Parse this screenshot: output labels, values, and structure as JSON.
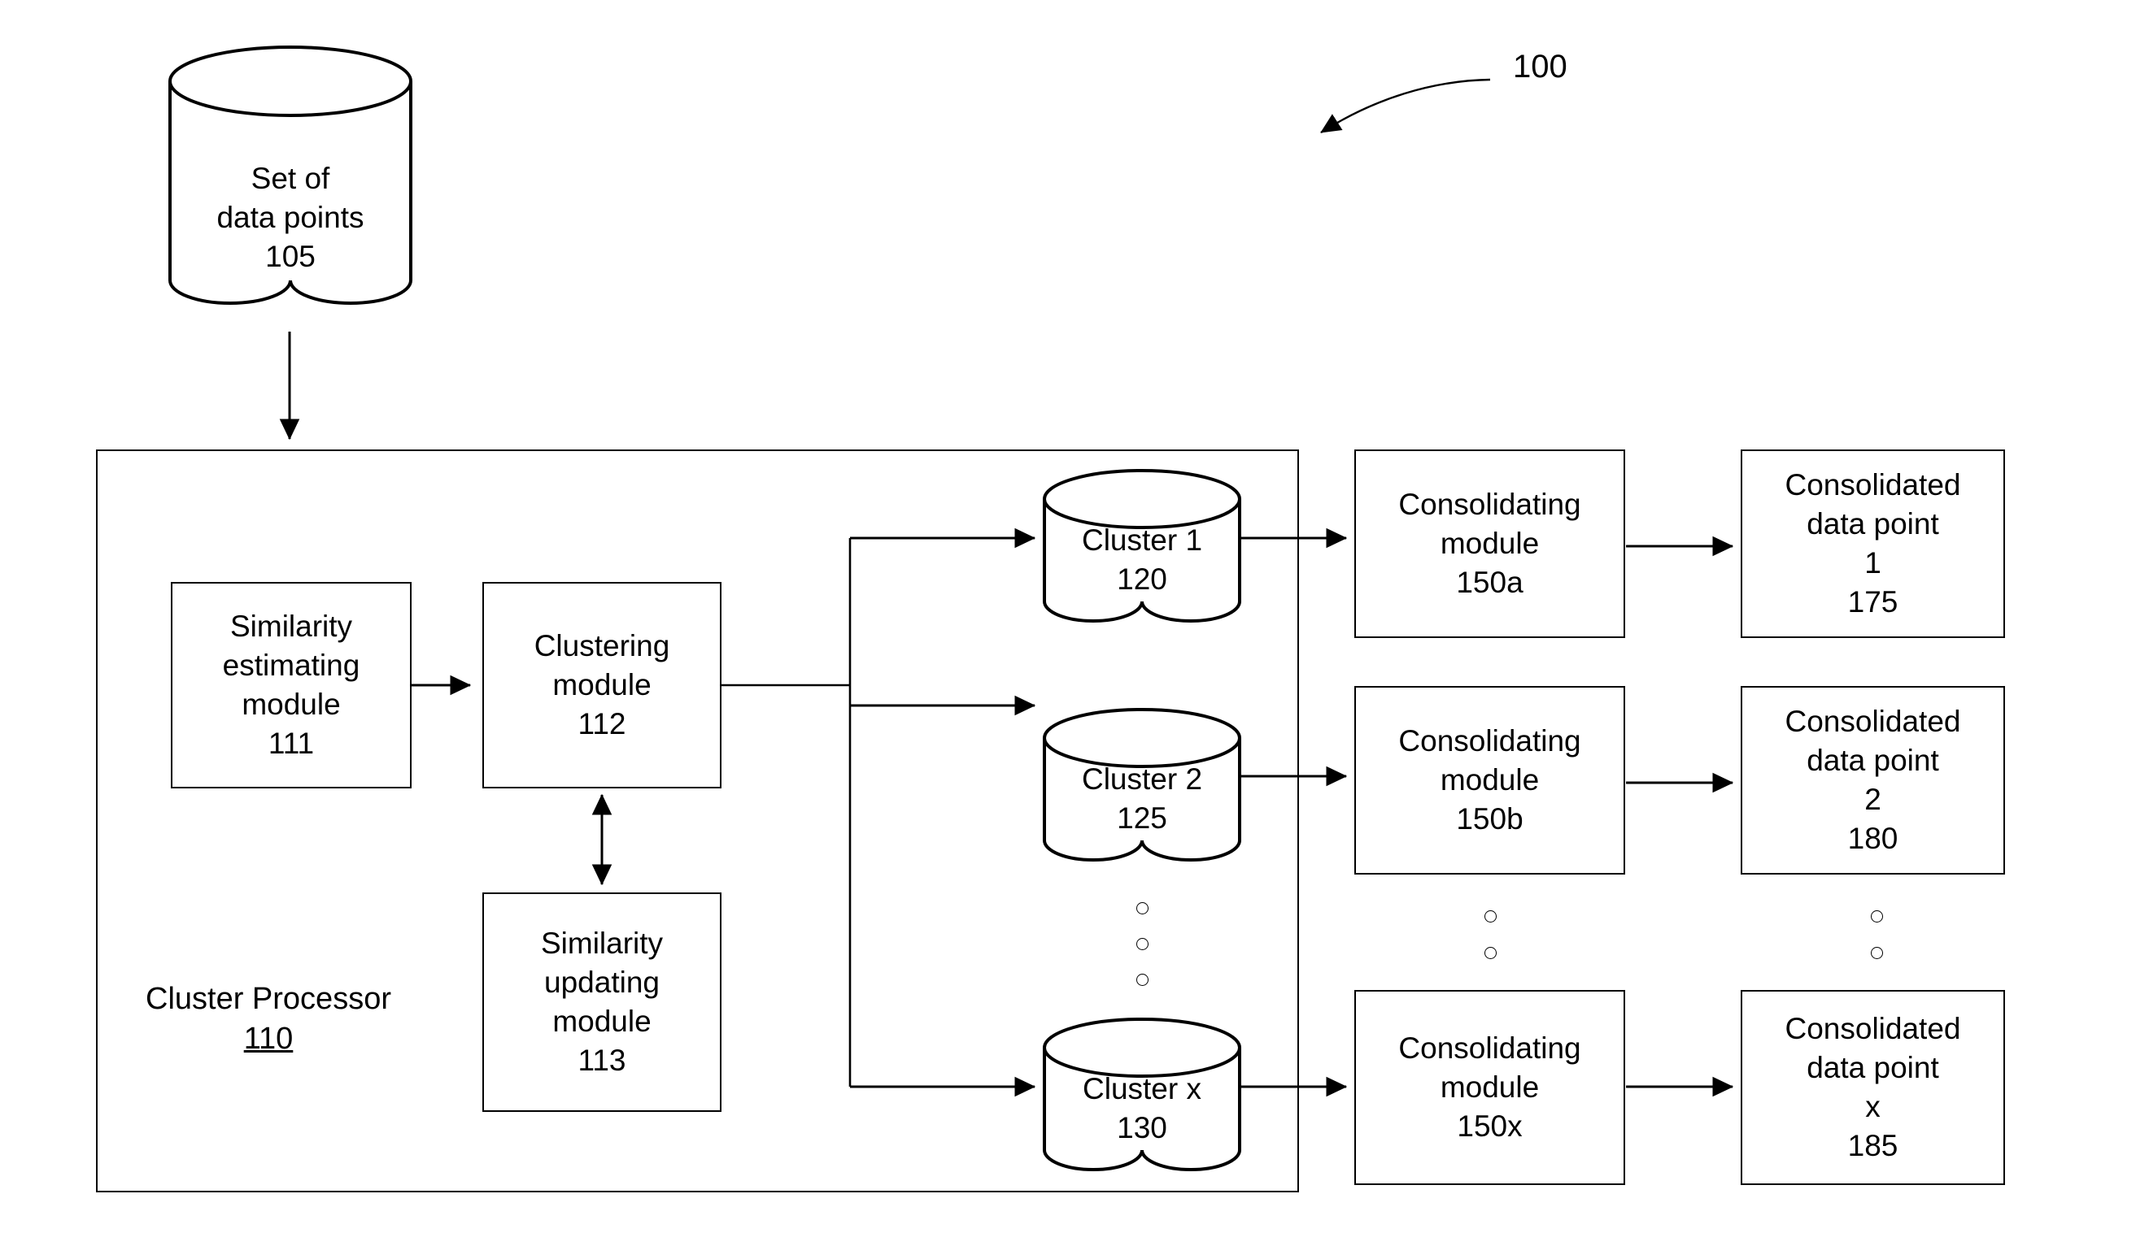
{
  "figure": {
    "reference_numeral": "100"
  },
  "source": {
    "name": "set-of-data-points",
    "lines": [
      "Set of",
      "data points",
      "105"
    ]
  },
  "cluster_processor": {
    "title": "Cluster Processor",
    "reference": "110",
    "modules": [
      {
        "name": "similarity-estimating-module",
        "lines": [
          "Similarity",
          "estimating",
          "module",
          "111"
        ]
      },
      {
        "name": "clustering-module",
        "lines": [
          "Clustering",
          "module",
          "112"
        ]
      },
      {
        "name": "similarity-updating-module",
        "lines": [
          "Similarity",
          "updating",
          "module",
          "113"
        ]
      }
    ],
    "clusters": [
      {
        "name": "cluster-1",
        "lines": [
          "Cluster 1",
          "120"
        ]
      },
      {
        "name": "cluster-2",
        "lines": [
          "Cluster 2",
          "125"
        ]
      },
      {
        "name": "cluster-x",
        "lines": [
          "Cluster x",
          "130"
        ]
      }
    ]
  },
  "consolidating_modules": [
    {
      "name": "consolidating-module-150a",
      "lines": [
        "Consolidating",
        "module",
        "150a"
      ]
    },
    {
      "name": "consolidating-module-150b",
      "lines": [
        "Consolidating",
        "module",
        "150b"
      ]
    },
    {
      "name": "consolidating-module-150x",
      "lines": [
        "Consolidating",
        "module",
        "150x"
      ]
    }
  ],
  "consolidated_data_points": [
    {
      "name": "consolidated-data-point-175",
      "lines": [
        "Consolidated",
        "data point",
        "1",
        "175"
      ]
    },
    {
      "name": "consolidated-data-point-180",
      "lines": [
        "Consolidated",
        "data point",
        "2",
        "180"
      ]
    },
    {
      "name": "consolidated-data-point-185",
      "lines": [
        "Consolidated",
        "data point",
        "x",
        "185"
      ]
    }
  ],
  "colors": {
    "stroke": "#000000",
    "background": "#ffffff",
    "text": "#000000"
  }
}
